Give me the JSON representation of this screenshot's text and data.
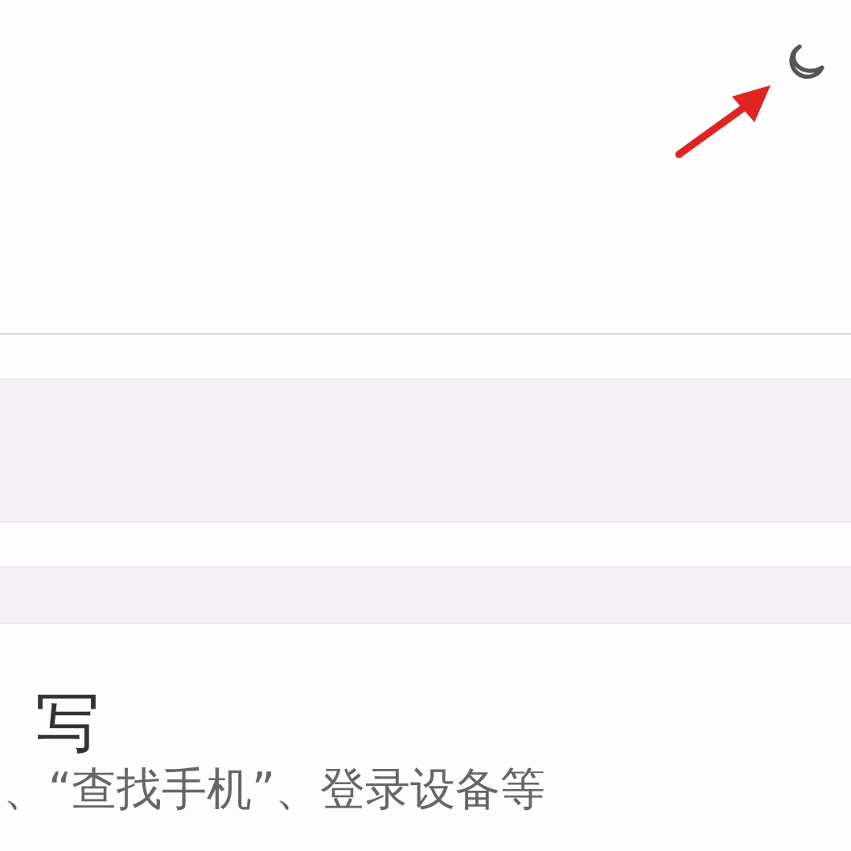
{
  "header": {
    "icons": [
      {
        "kind": "moon"
      }
    ]
  },
  "annotation": {
    "kind": "arrow"
  },
  "section": {
    "title": "写",
    "subtitle": "、“查找手机”、登录设备等"
  }
}
